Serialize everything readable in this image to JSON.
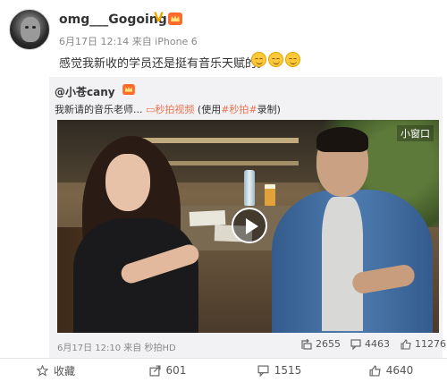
{
  "post": {
    "username": "omg___Gogoing",
    "verified_badge": "V",
    "meta": "6月17日 12:14 来自 iPhone 6",
    "text": "感觉我新收的学员还是挺有音乐天赋的。",
    "emoji_count": 3
  },
  "repost": {
    "username": "@小苍cany",
    "text_prefix": "我新请的音乐老师... ",
    "video_link": "秒拍视频",
    "text_middle": " (使用",
    "tag": "#秒拍#",
    "text_suffix": "录制)",
    "mini_window": "小窗口",
    "meta": "6月17日 12:10 来自 秒拍HD",
    "stats": {
      "forwards": "2655",
      "comments": "4463",
      "likes": "11276"
    }
  },
  "actions": {
    "favorite": "收藏",
    "forward": "601",
    "comment": "1515",
    "like": "4640"
  },
  "colors": {
    "link": "#eb7350",
    "badge": "#f0a800",
    "repost_bg": "#f2f2f5"
  }
}
